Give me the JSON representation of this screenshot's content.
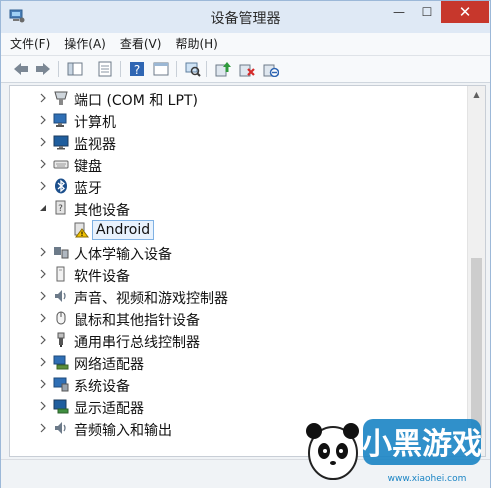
{
  "window": {
    "title": "设备管理器",
    "close": "✕",
    "maximize": "☐",
    "minimize": "—"
  },
  "menu": [
    {
      "label": "文件(F)"
    },
    {
      "label": "操作(A)"
    },
    {
      "label": "查看(V)"
    },
    {
      "label": "帮助(H)"
    }
  ],
  "toolbar": [
    "back-icon",
    "forward-icon",
    "properties-panel-icon",
    "sheet-icon",
    "help-icon",
    "view-icon",
    "scan-hardware-icon",
    "update-driver-icon",
    "uninstall-icon",
    "disable-icon"
  ],
  "tree": [
    {
      "label": "端口 (COM 和 LPT)",
      "icon": "port-icon",
      "expanded": false
    },
    {
      "label": "计算机",
      "icon": "computer-icon",
      "expanded": false
    },
    {
      "label": "监视器",
      "icon": "monitor-icon",
      "expanded": false
    },
    {
      "label": "键盘",
      "icon": "keyboard-icon",
      "expanded": false
    },
    {
      "label": "蓝牙",
      "icon": "bluetooth-icon",
      "expanded": false
    },
    {
      "label": "其他设备",
      "icon": "other-devices-icon",
      "expanded": true
    },
    {
      "label": "Android",
      "icon": "warning-device-icon",
      "child": true
    },
    {
      "label": "人体学输入设备",
      "icon": "hid-icon",
      "expanded": false
    },
    {
      "label": "软件设备",
      "icon": "software-device-icon",
      "expanded": false
    },
    {
      "label": "声音、视频和游戏控制器",
      "icon": "speaker-icon",
      "expanded": false
    },
    {
      "label": "鼠标和其他指针设备",
      "icon": "mouse-icon",
      "expanded": false
    },
    {
      "label": "通用串行总线控制器",
      "icon": "usb-icon",
      "expanded": false
    },
    {
      "label": "网络适配器",
      "icon": "network-icon",
      "expanded": false
    },
    {
      "label": "系统设备",
      "icon": "system-device-icon",
      "expanded": false
    },
    {
      "label": "显示适配器",
      "icon": "display-adapter-icon",
      "expanded": false
    },
    {
      "label": "音频输入和输出",
      "icon": "audio-io-icon",
      "expanded": false
    }
  ],
  "watermark": {
    "brand": "小黑游戏",
    "url": "www.xiaohei.com"
  },
  "colors": {
    "close_button": "#c7372c",
    "title_bar": "#dfe9f5",
    "selection_border": "#7fb1e3",
    "warning": "#f2c200"
  }
}
